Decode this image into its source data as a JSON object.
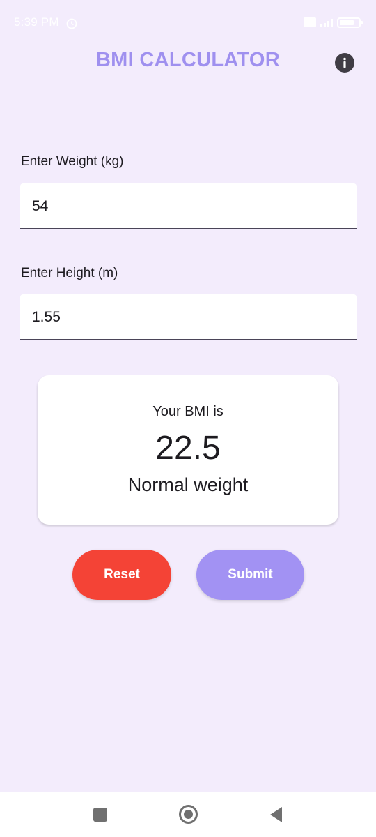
{
  "status_bar": {
    "time": "5:39 PM",
    "icons": [
      "alarm-icon",
      "sim-icon",
      "signal-icon",
      "battery-icon"
    ]
  },
  "app_bar": {
    "title": "BMI CALCULATOR",
    "info_icon": "info-icon"
  },
  "weight_field": {
    "label": "Enter Weight (kg)",
    "value": "54"
  },
  "height_field": {
    "label": "Enter Height (m)",
    "value": "1.55"
  },
  "result": {
    "caption": "Your BMI is",
    "value": "22.5",
    "category": "Normal weight"
  },
  "buttons": {
    "reset": "Reset",
    "submit": "Submit"
  },
  "nav_bar": {
    "icons": [
      "recents-icon",
      "home-icon",
      "back-icon"
    ]
  },
  "colors": {
    "background": "#f3ecfc",
    "title": "#9f90ef",
    "reset": "#f44336",
    "submit": "#a292f3"
  }
}
